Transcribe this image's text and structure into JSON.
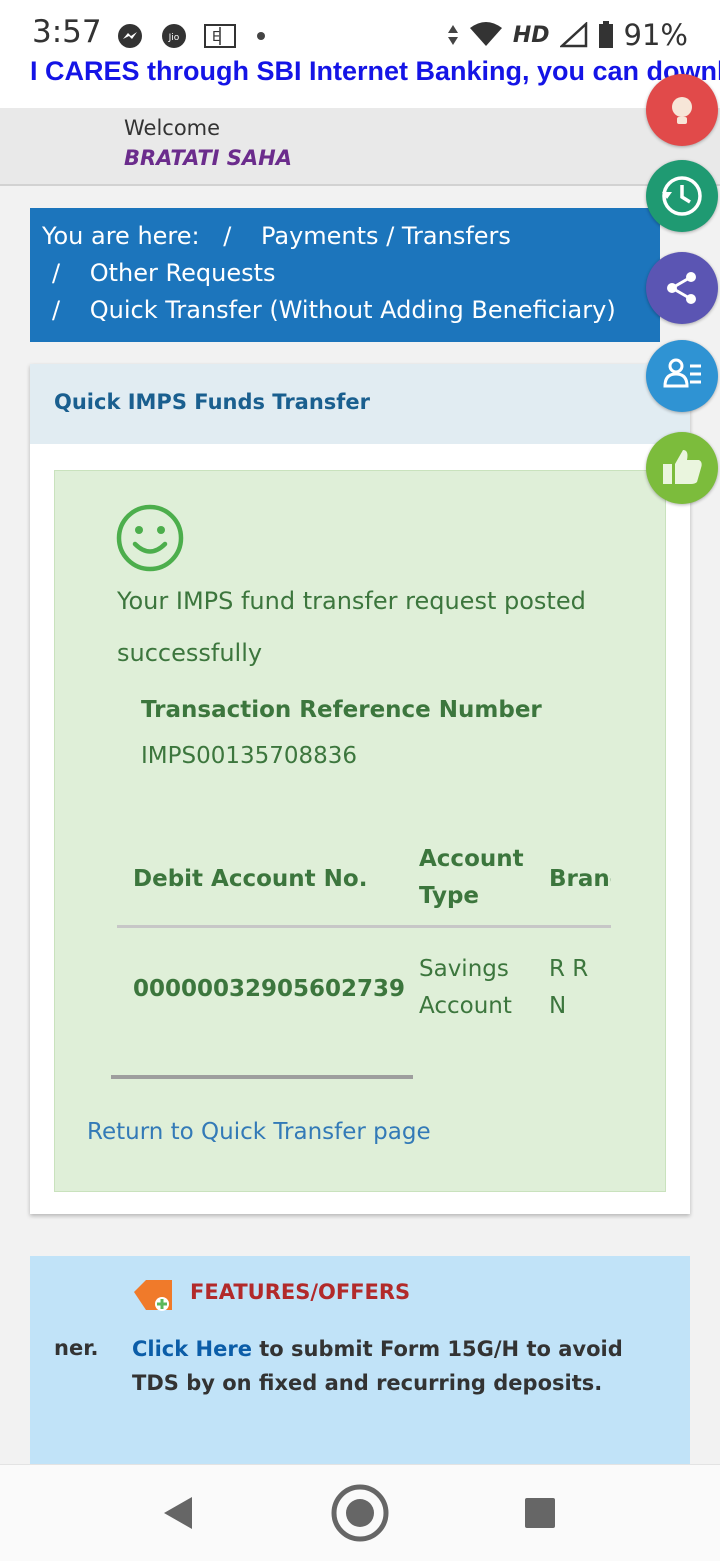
{
  "status_bar": {
    "time": "3:57",
    "network": "HD",
    "battery": "91%",
    "icons": [
      "messenger-icon",
      "jio-icon",
      "keyboard-icon",
      "dot-icon",
      "data-arrows-icon",
      "wifi-icon",
      "signal-icon",
      "battery-icon"
    ]
  },
  "marquee": {
    "text": "I CARES through SBI Internet Banking, you can downlo"
  },
  "welcome": {
    "label": "Welcome",
    "name": "BRATATI SAHA"
  },
  "breadcrumb": {
    "prefix": "You are here:",
    "sep": "/",
    "items": [
      "Payments / Transfers",
      "Other Requests",
      "Quick Transfer (Without Adding Beneficiary)"
    ]
  },
  "card": {
    "title": "Quick IMPS Funds Transfer",
    "message": "Your IMPS fund transfer request posted successfully",
    "ref_label": "Transaction Reference Number",
    "ref_value": "IMPS00135708836",
    "table": {
      "headers": [
        "Debit Account No.",
        "Account Type",
        "Branc"
      ],
      "row": [
        "00000032905602739",
        "Savings Account",
        "R R N ROAD"
      ]
    },
    "return_link": "Return to Quick Transfer page"
  },
  "features": {
    "title": "FEATURES/OFFERS",
    "left_fragment": "ner.",
    "link_text": "Click Here",
    "text": " to submit Form 15G/H to avoid TDS by on fixed and recurring deposits."
  },
  "floating_buttons": [
    {
      "icon": "lightbulb-icon",
      "color": "#e14a4a"
    },
    {
      "icon": "history-clock-icon",
      "color": "#1f9a72"
    },
    {
      "icon": "share-icon",
      "color": "#5b55b3"
    },
    {
      "icon": "profile-list-icon",
      "color": "#2f93d3"
    },
    {
      "icon": "thumbs-up-icon",
      "color": "#7cbc3c"
    }
  ],
  "nav": {
    "icons": [
      "back-icon",
      "home-icon",
      "recents-icon"
    ]
  }
}
